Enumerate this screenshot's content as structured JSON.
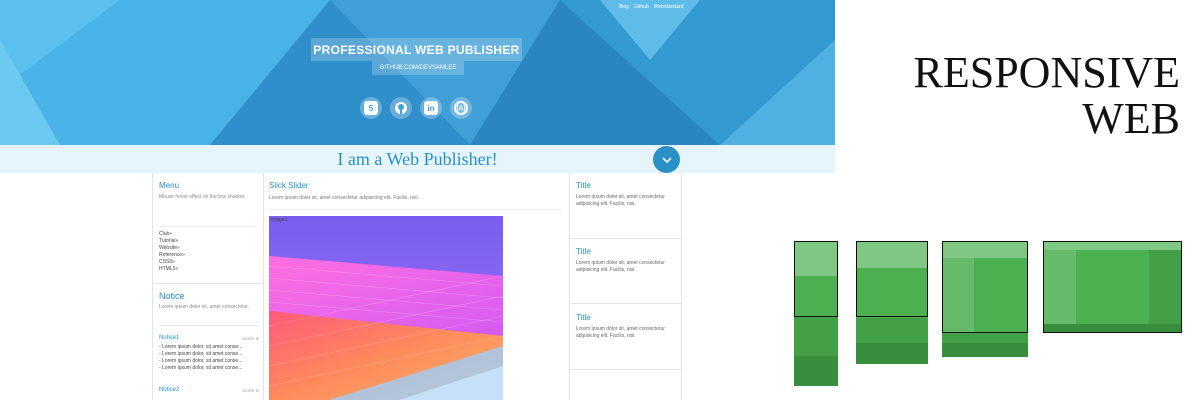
{
  "topnav": [
    "Blog",
    "Github",
    "Webstandard"
  ],
  "hero": {
    "brand": "PROFESSIONAL WEB PUBLISHER",
    "github": "GITHUB.COM/DEVSAMLEE",
    "social_icons": [
      "html5-icon",
      "github-icon",
      "linkedin-icon",
      "freecodecamp-icon"
    ]
  },
  "banner": {
    "text": "I am a Web Publisher!",
    "toggle_icon": "chevron-down-icon"
  },
  "left": {
    "menu_title": "Menu",
    "menu_desc": "Mouse hover effect on the box shadow",
    "links": [
      "Club»",
      "Tutorial»",
      "Website»",
      "Reference»",
      "CSS3»",
      "HTML5»"
    ],
    "notice_title": "Notice",
    "notice_desc": "Lorem ipsum dolor sit, amet consectetur.",
    "notices": [
      {
        "title": "Notice1",
        "more": "MORE ⊕",
        "items": [
          "- Lorem ipsum dolor, sit amet conse...",
          "- Lorem ipsum dolor, sit amet conse...",
          "- Lorem ipsum dolor, sit amet conse...",
          "- Lorem ipsum dolor, sit amet conse..."
        ]
      },
      {
        "title": "Notice2",
        "more": "MORE ⊕",
        "items": []
      }
    ]
  },
  "middle": {
    "title": "Slick Slider",
    "desc": "Lorem ipsum dolor sit, amet consectetur adipisicing elit. Facilis, nisi.",
    "image_alt": "image1"
  },
  "right": {
    "cards": [
      {
        "title": "Title",
        "desc": "Lorem ipsum dolor sit, amet consectetur adipisicing elit. Facilis, nisi."
      },
      {
        "title": "Title",
        "desc": "Lorem ipsum dolor sit, amet consectetur adipisicing elit. Facilis, nisi."
      },
      {
        "title": "Title",
        "desc": "Lorem ipsum dolor sit, amet consectetur adipisicing elit. Facilis, nisi."
      }
    ]
  },
  "headline": {
    "line1": "RESPONSIVE",
    "line2": "WEB"
  },
  "colors": {
    "accent_blue": "#2a90c6",
    "hero_blue": "#3aa1d9",
    "green_light": "#81c784",
    "green_mid": "#4caf50",
    "green_dark": "#388e3c"
  }
}
